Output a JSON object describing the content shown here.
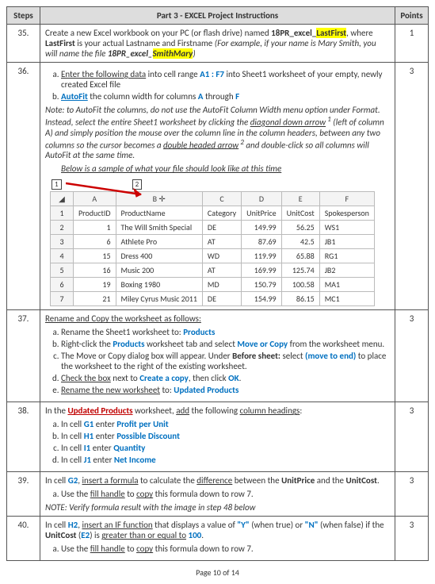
{
  "header": {
    "steps": "Steps",
    "part": "Part 3 - EXCEL Project Instructions",
    "points": "Points"
  },
  "rows": {
    "r35": {
      "num": "35.",
      "pts": "1",
      "t1": "Create a new Excel workbook on your PC (or flash drive) named ",
      "t2": "18PR_excel_",
      "t3": "LastFirst",
      "t4": ", where ",
      "t5": "LastFirst",
      "t6": " is your actual Lastname and Firstname ",
      "t7": "(For example, if your name is Mary Smith, you will name the file ",
      "t8": "18PR_excel_",
      "t9": "SmithMary",
      "t10": ")"
    },
    "r36": {
      "num": "36.",
      "pts": "3",
      "a1": "Enter the following data",
      "a2": " into cell range ",
      "a3": "A1 : F7",
      "a4": " into Sheet1 worksheet of your empty, newly created Excel file",
      "b1": "AutoFit",
      "b2": " the column width for columns ",
      "b3": "A",
      "b4": " through ",
      "b5": "F",
      "note1": "Note: to AutoFit the columns, do not use the AutoFit Column Width menu option under Format. Instead, select the entire Sheet1 worksheet by clicking the ",
      "note2": "diagonal down arrow",
      "sup1": " 1",
      "note3": " (left of column A) and simply position the mouse over the column line in the column headers, between any two columns so the cursor becomes a ",
      "note4": "double headed arrow",
      "sup2": " 2",
      "note5": " and double-click so all columns will AutoFit at the same time.",
      "below": "Below is a sample of what your file should look like at this time",
      "call1": "1",
      "call2": "2"
    },
    "r37": {
      "num": "37.",
      "pts": "3",
      "lead": "Rename and Copy the worksheet as follows:",
      "a1": "Rename the Sheet1 worksheet to: ",
      "a2": "Products",
      "b1": "Right-click the ",
      "b2": "Products",
      "b3": " worksheet tab and select ",
      "b4": "Move or Copy",
      "b5": " from the worksheet menu.",
      "c1": "The Move or Copy dialog box will appear. Under ",
      "c2": "Before sheet:",
      "c3": " select ",
      "c4": "(move to end)",
      "c5": " to place the worksheet to the right of the existing worksheet.",
      "d1": "Check the box",
      "d2": " next to ",
      "d3": "Create a copy",
      "d4": ", then click ",
      "d5": "OK",
      "d6": ".",
      "e1": "Rename the new worksheet",
      "e2": " to: ",
      "e3": "Updated Products"
    },
    "r38": {
      "num": "38.",
      "pts": "3",
      "lead1": "In the ",
      "lead2": "Updated Products",
      "lead3": " worksheet, ",
      "lead4": "add",
      "lead5": " the following ",
      "lead6": "column headings",
      "lead7": ":",
      "a1": "In cell ",
      "a2": "G1",
      "a3": " enter ",
      "a4": "Profit per Unit",
      "b1": "In cell ",
      "b2": "H1",
      "b3": " enter ",
      "b4": "Possible Discount",
      "c1": "In cell ",
      "c2": "I1",
      "c3": " enter ",
      "c4": "Quantity",
      "d1": "In cell ",
      "d2": "J1",
      "d3": " enter ",
      "d4": "Net Income"
    },
    "r39": {
      "num": "39.",
      "pts": "3",
      "t1": "In cell ",
      "t2": "G2",
      "t3": ", ",
      "t4": "insert a formula",
      "t5": " to calculate the ",
      "t6": "difference",
      "t7": " between the ",
      "t8": "UnitPrice",
      "t9": " and the ",
      "t10": "UnitCost",
      "t11": ".",
      "a1": "Use the ",
      "a2": "fill handle",
      "a3": " to ",
      "a4": "copy",
      "a5": " this formula down to row 7.",
      "note": "NOTE: Verify formula result with the image in step 48 below"
    },
    "r40": {
      "num": "40.",
      "pts": "3",
      "t1": "In cell ",
      "t2": "H2",
      "t3": ", ",
      "t4": "insert an IF function",
      "t5": " that displays a value of ",
      "t6": "\"Y\"",
      "t7": " (when true) or ",
      "t8": "\"N\"",
      "t9": " (when false) if the ",
      "t10": "UnitCost",
      "t11": " (",
      "t12": "E2",
      "t13": ") is ",
      "t14": "greater than or equal to",
      "t15": " ",
      "t16": "100",
      "t17": ".",
      "a1": "Use the ",
      "a2": "fill handle",
      "a3": " to ",
      "a4": "copy",
      "a5": " this formula down to row 7."
    }
  },
  "excel": {
    "cols": [
      "",
      "A",
      "B",
      "C",
      "D",
      "E",
      "F"
    ],
    "head": [
      "1",
      "ProductID",
      "ProductName",
      "Category",
      "UnitPrice",
      "UnitCost",
      "Spokesperson"
    ],
    "rows": [
      [
        "2",
        "1",
        "The Will Smith Special",
        "DE",
        "149.99",
        "56.25",
        "WS1"
      ],
      [
        "3",
        "6",
        "Athlete Pro",
        "AT",
        "87.69",
        "42.5",
        "JB1"
      ],
      [
        "4",
        "15",
        "Dress 400",
        "WD",
        "119.99",
        "65.88",
        "RG1"
      ],
      [
        "5",
        "16",
        "Music 200",
        "AT",
        "169.99",
        "125.74",
        "JB2"
      ],
      [
        "6",
        "19",
        "Boxing 1980",
        "MD",
        "150.79",
        "100.58",
        "MA1"
      ],
      [
        "7",
        "21",
        "Miley Cyrus Music 2011",
        "DE",
        "154.99",
        "86.15",
        "MC1"
      ]
    ]
  },
  "footer": "Page 10 of 14"
}
